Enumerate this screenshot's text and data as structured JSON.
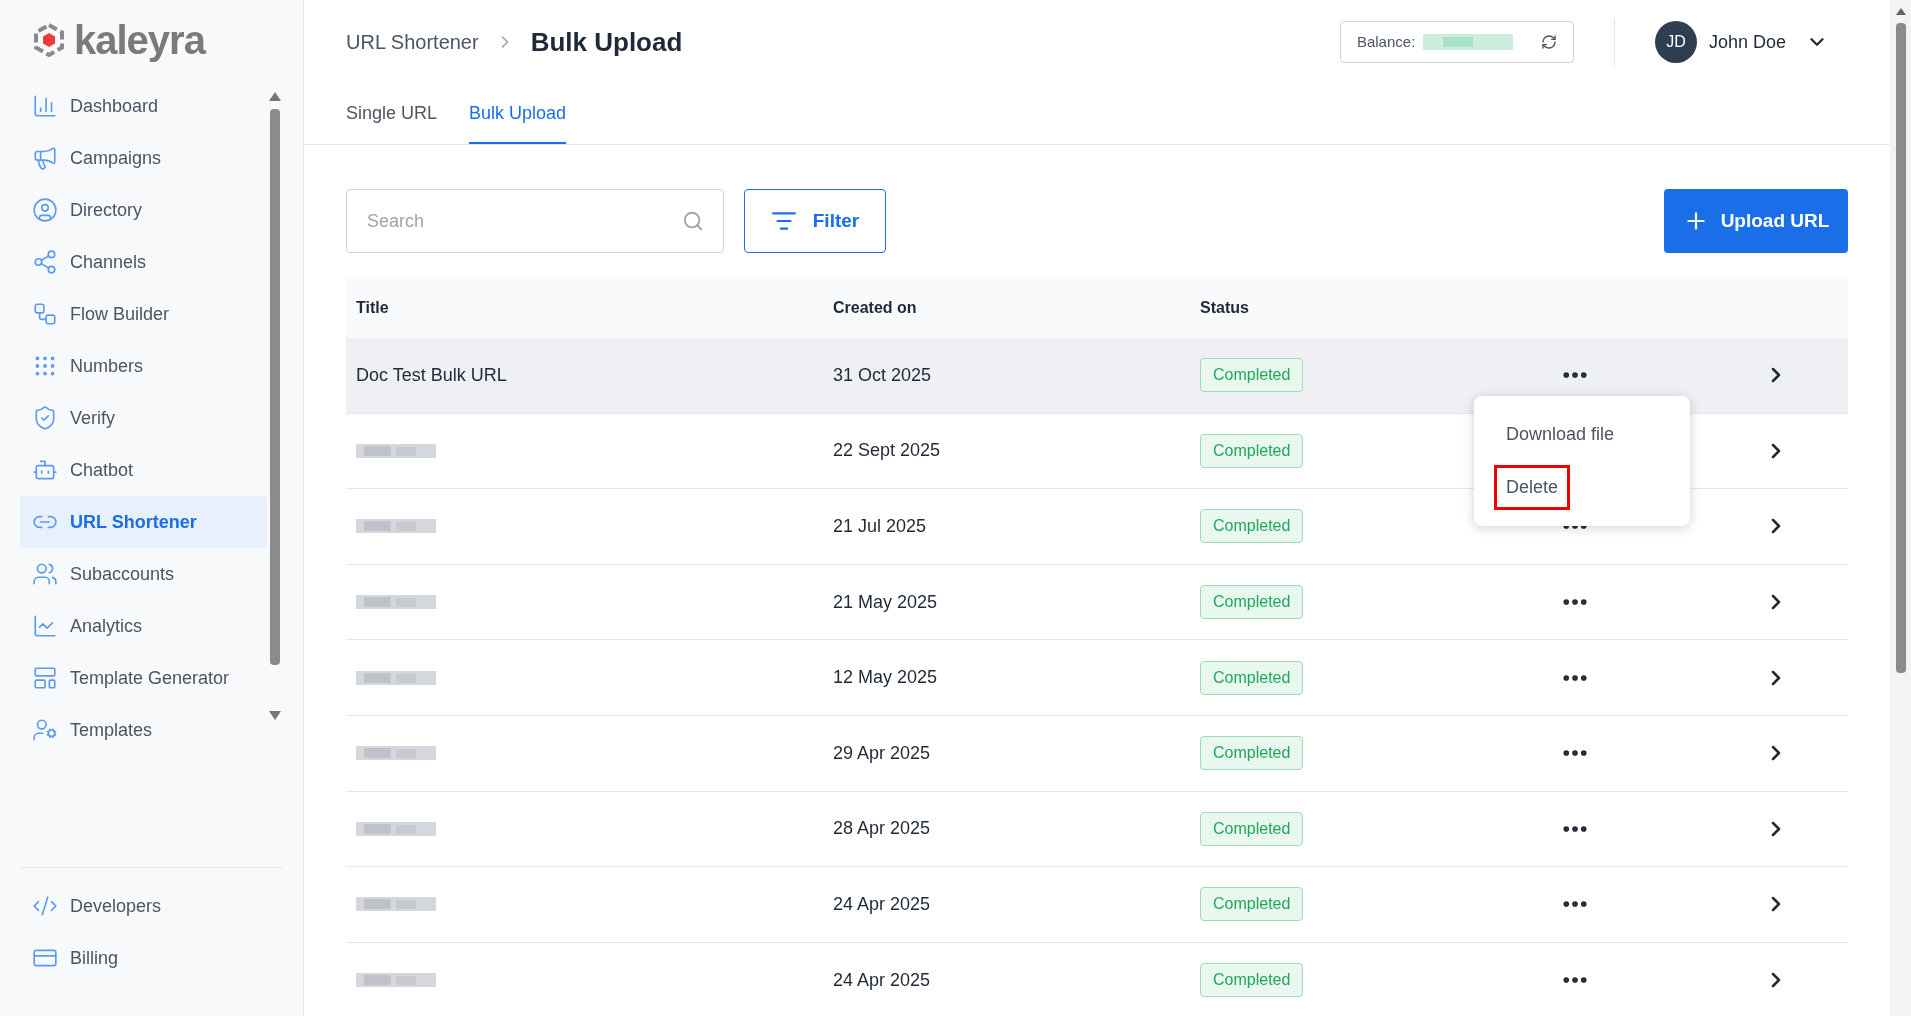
{
  "logo": {
    "text": "kaleyra"
  },
  "sidebar": {
    "items": [
      {
        "label": "Dashboard",
        "selected": false
      },
      {
        "label": "Campaigns",
        "selected": false
      },
      {
        "label": "Directory",
        "selected": false
      },
      {
        "label": "Channels",
        "selected": false
      },
      {
        "label": "Flow Builder",
        "selected": false
      },
      {
        "label": "Numbers",
        "selected": false
      },
      {
        "label": "Verify",
        "selected": false
      },
      {
        "label": "Chatbot",
        "selected": false
      },
      {
        "label": "URL Shortener",
        "selected": true
      },
      {
        "label": "Subaccounts",
        "selected": false
      },
      {
        "label": "Analytics",
        "selected": false
      },
      {
        "label": "Template Generator",
        "selected": false
      },
      {
        "label": "Templates",
        "selected": false
      }
    ],
    "bottom_items": [
      {
        "label": "Developers",
        "selected": false
      },
      {
        "label": "Billing",
        "selected": false
      }
    ]
  },
  "breadcrumb": {
    "parent": "URL Shortener",
    "current": "Bulk Upload"
  },
  "balance": {
    "label": "Balance:",
    "value_redacted": true
  },
  "user": {
    "initials": "JD",
    "name": "John Doe"
  },
  "tabs": [
    {
      "label": "Single URL",
      "selected": false
    },
    {
      "label": "Bulk Upload",
      "selected": true
    }
  ],
  "search": {
    "placeholder": "Search"
  },
  "filter_button": "Filter",
  "upload_button": "Upload URL",
  "table": {
    "columns": [
      "Title",
      "Created on",
      "Status"
    ],
    "rows": [
      {
        "title": "Doc Test Bulk URL",
        "redacted": false,
        "created": "31 Oct 2025",
        "status": "Completed",
        "selected": true
      },
      {
        "redacted": true,
        "created": "22 Sept 2025",
        "status": "Completed",
        "selected": false
      },
      {
        "redacted": true,
        "created": "21 Jul 2025",
        "status": "Completed",
        "selected": false
      },
      {
        "redacted": true,
        "created": "21 May 2025",
        "status": "Completed",
        "selected": false
      },
      {
        "redacted": true,
        "created": "12 May 2025",
        "status": "Completed",
        "selected": false
      },
      {
        "redacted": true,
        "created": "29 Apr 2025",
        "status": "Completed",
        "selected": false
      },
      {
        "redacted": true,
        "created": "28 Apr 2025",
        "status": "Completed",
        "selected": false
      },
      {
        "redacted": true,
        "created": "24 Apr 2025",
        "status": "Completed",
        "selected": false
      },
      {
        "redacted": true,
        "created": "24 Apr 2025",
        "status": "Completed",
        "selected": false
      }
    ]
  },
  "row_menu": {
    "items": [
      {
        "label": "Download file",
        "highlighted": false
      },
      {
        "label": "Delete",
        "highlighted": true
      }
    ]
  }
}
